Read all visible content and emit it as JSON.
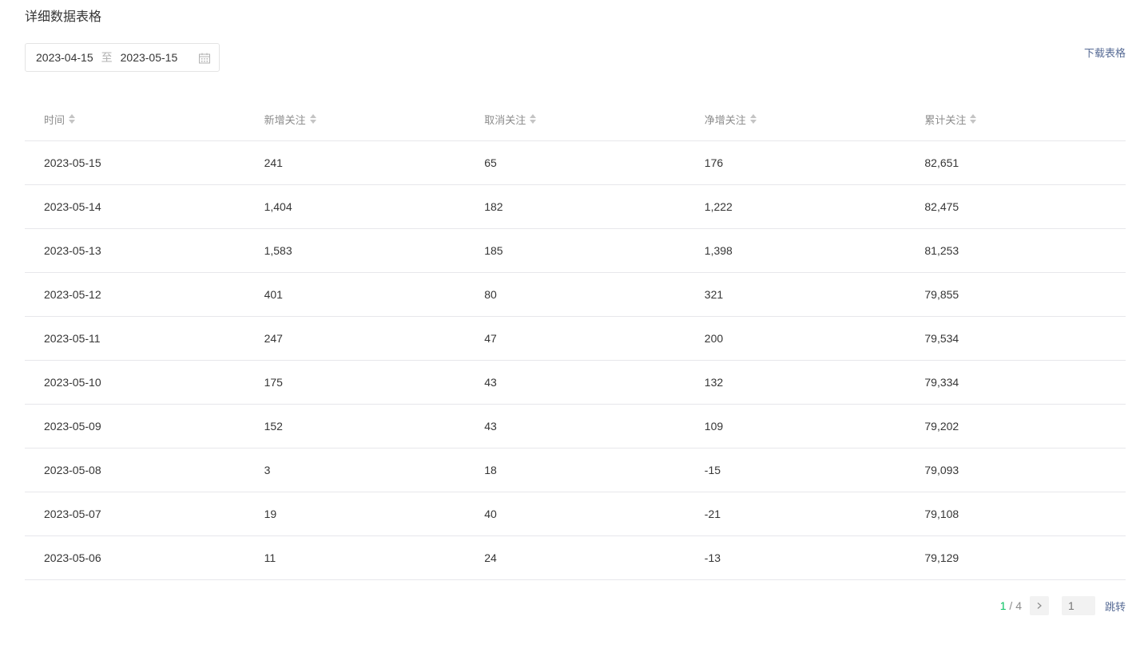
{
  "title": "详细数据表格",
  "date_range": {
    "start": "2023-04-15",
    "separator": "至",
    "end": "2023-05-15"
  },
  "download_label": "下载表格",
  "table": {
    "headers": [
      "时间",
      "新增关注",
      "取消关注",
      "净增关注",
      "累计关注"
    ],
    "rows": [
      [
        "2023-05-15",
        "241",
        "65",
        "176",
        "82,651"
      ],
      [
        "2023-05-14",
        "1,404",
        "182",
        "1,222",
        "82,475"
      ],
      [
        "2023-05-13",
        "1,583",
        "185",
        "1,398",
        "81,253"
      ],
      [
        "2023-05-12",
        "401",
        "80",
        "321",
        "79,855"
      ],
      [
        "2023-05-11",
        "247",
        "47",
        "200",
        "79,534"
      ],
      [
        "2023-05-10",
        "175",
        "43",
        "132",
        "79,334"
      ],
      [
        "2023-05-09",
        "152",
        "43",
        "109",
        "79,202"
      ],
      [
        "2023-05-08",
        "3",
        "18",
        "-15",
        "79,093"
      ],
      [
        "2023-05-07",
        "19",
        "40",
        "-21",
        "79,108"
      ],
      [
        "2023-05-06",
        "11",
        "24",
        "-13",
        "79,129"
      ]
    ]
  },
  "pagination": {
    "current": "1",
    "separator": " / ",
    "total": "4",
    "input_placeholder": "1",
    "jump_label": "跳转"
  },
  "colors": {
    "accent_green": "#07c160",
    "link_blue": "#576b95",
    "divider": "#e7e7eb"
  }
}
